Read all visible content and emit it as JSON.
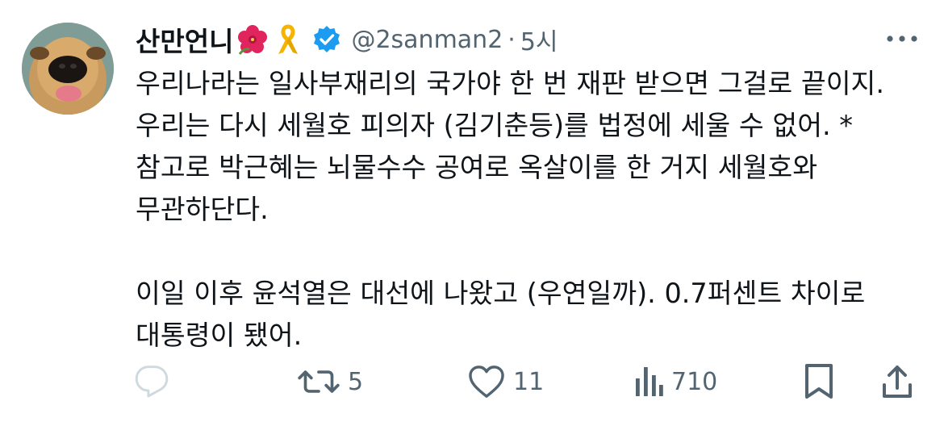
{
  "tweet": {
    "display_name": "산만언니",
    "handle": "@2sanman2",
    "separator": "·",
    "time": "5시",
    "body": "우리나라는 일사부재리의 국가야 한 번 재판 받으면 그걸로 끝이지. 우리는 다시 세월호 피의자 (김기춘등)를 법정에 세울 수 없어. * 참고로 박근혜는 뇌물수수 공여로 옥살이를 한 거지 세월호와 무관하단다.\n\n이일 이후 윤석열은 대선에 나왔고 (우연일까). 0.7퍼센트 차이로 대통령이 됐어."
  },
  "actions": {
    "reply_count": "",
    "retweet_count": "5",
    "like_count": "11",
    "view_count": "710"
  },
  "icons": {
    "emoji_1": "hibiscus-emoji",
    "emoji_2": "yellow-ribbon-emoji",
    "verified": "verified-badge-icon",
    "more": "more-options-icon",
    "reply": "reply-icon",
    "retweet": "retweet-icon",
    "like": "heart-icon",
    "views": "views-chart-icon",
    "bookmark": "bookmark-icon",
    "share": "share-icon"
  },
  "colors": {
    "text": "#0f1419",
    "secondary": "#536471",
    "verified_blue": "#1d9bf0"
  }
}
